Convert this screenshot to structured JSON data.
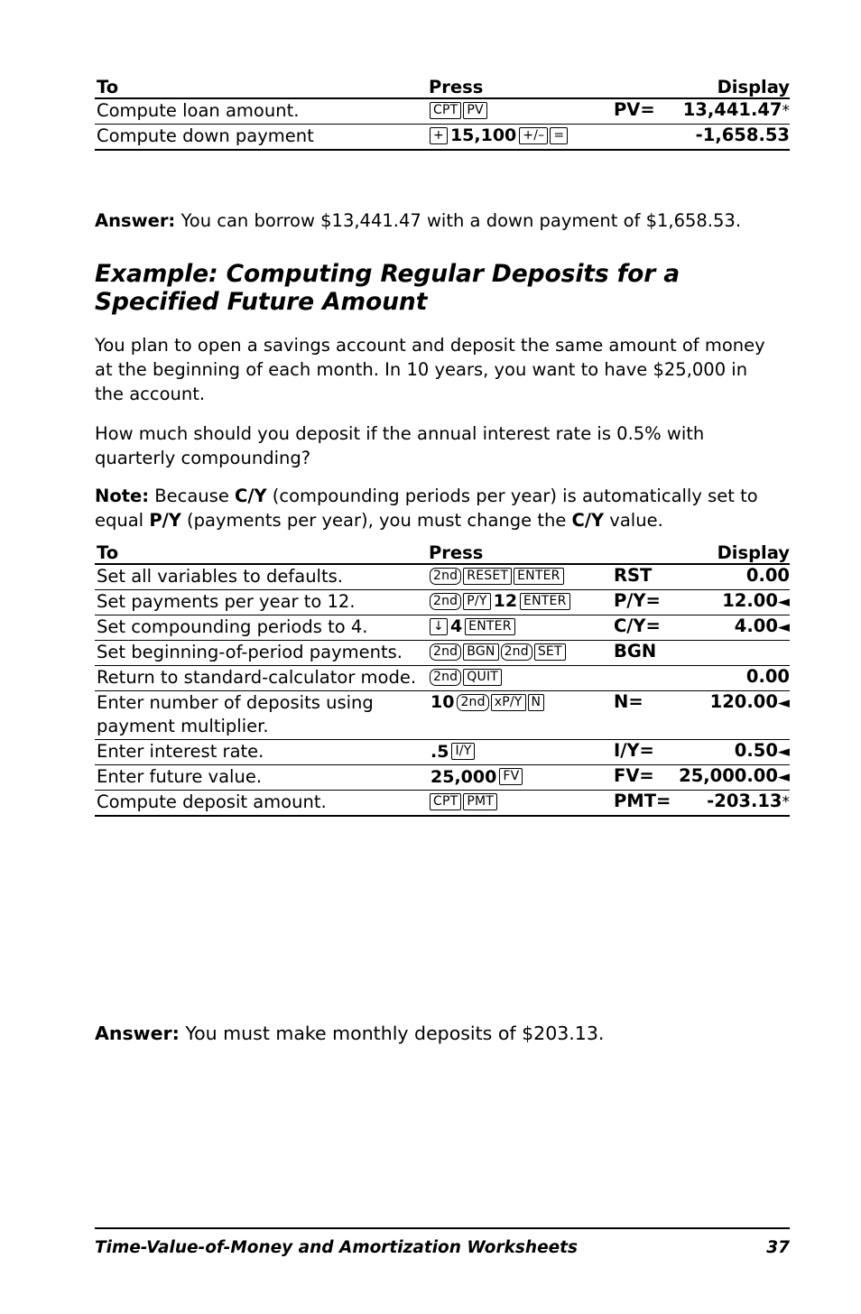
{
  "table1": {
    "headers": {
      "to": "To",
      "press": "Press",
      "display": "Display"
    },
    "rows": [
      {
        "to": "Compute loan amount.",
        "keys": [
          {
            "type": "key",
            "text": "CPT"
          },
          {
            "type": "key",
            "text": "PV"
          }
        ],
        "disp_label": "PV=",
        "disp_value": "13,441.47",
        "mark": "*"
      },
      {
        "to": "Compute down payment",
        "keys": [
          {
            "type": "key",
            "text": "+"
          },
          {
            "type": "num",
            "text": "15,100"
          },
          {
            "type": "key",
            "text": "+/–"
          },
          {
            "type": "key",
            "text": "="
          }
        ],
        "disp_label": "",
        "disp_value": "-1,658.53",
        "mark": ""
      }
    ]
  },
  "answer1": {
    "label": "Answer:",
    "text": " You can borrow $13,441.47 with a down payment of $1,658.53."
  },
  "heading": "Example: Computing Regular Deposits for a Specified Future Amount",
  "para1": "You plan to open a savings account and deposit the same amount of money at the beginning of each month. In 10 years, you want to have $25,000 in the account.",
  "para2": "How much should you deposit if the annual interest rate is 0.5% with quarterly compounding?",
  "note": {
    "label": "Note:",
    "part1": " Because ",
    "cy1": "C/Y",
    "part2": " (compounding periods per year) is automatically set to equal ",
    "py": "P/Y",
    "part3": " (payments per year), you must change the ",
    "cy2": "C/Y",
    "part4": " value."
  },
  "table2": {
    "headers": {
      "to": "To",
      "press": "Press",
      "display": "Display"
    },
    "rows": [
      {
        "to": "Set all variables to defaults.",
        "keys": [
          {
            "type": "key2nd",
            "text": "2nd"
          },
          {
            "type": "key",
            "text": "RESET"
          },
          {
            "type": "key",
            "text": "ENTER"
          }
        ],
        "disp_label": "RST",
        "disp_value": "0.00",
        "mark": ""
      },
      {
        "to": "Set payments per year to 12.",
        "keys": [
          {
            "type": "key2nd",
            "text": "2nd"
          },
          {
            "type": "key",
            "text": "P/Y"
          },
          {
            "type": "num",
            "text": "12"
          },
          {
            "type": "key",
            "text": "ENTER"
          }
        ],
        "disp_label": "P/Y=",
        "disp_value": "12.00",
        "mark": "◄"
      },
      {
        "to": "Set compounding periods to 4.",
        "keys": [
          {
            "type": "key",
            "text": "↓"
          },
          {
            "type": "num",
            "text": "4"
          },
          {
            "type": "key",
            "text": "ENTER"
          }
        ],
        "disp_label": "C/Y=",
        "disp_value": "4.00",
        "mark": "◄"
      },
      {
        "to": "Set beginning-of-period payments.",
        "keys": [
          {
            "type": "key2nd",
            "text": "2nd"
          },
          {
            "type": "key",
            "text": "BGN"
          },
          {
            "type": "key2nd",
            "text": "2nd"
          },
          {
            "type": "key",
            "text": "SET"
          }
        ],
        "disp_label": "BGN",
        "disp_value": "",
        "mark": ""
      },
      {
        "to": "Return to standard-calculator mode.",
        "keys": [
          {
            "type": "key2nd",
            "text": "2nd"
          },
          {
            "type": "key",
            "text": "QUIT"
          }
        ],
        "disp_label": "",
        "disp_value": "0.00",
        "mark": ""
      },
      {
        "to": "Enter number of deposits using payment multiplier.",
        "keys": [
          {
            "type": "num",
            "text": "10"
          },
          {
            "type": "key2nd",
            "text": "2nd"
          },
          {
            "type": "key",
            "text": "xP/Y"
          },
          {
            "type": "key",
            "text": "N"
          }
        ],
        "disp_label": "N=",
        "disp_value": "120.00",
        "mark": "◄"
      },
      {
        "to": "Enter interest rate.",
        "keys": [
          {
            "type": "num",
            "text": ".5"
          },
          {
            "type": "key",
            "text": "I/Y"
          }
        ],
        "disp_label": "I/Y=",
        "disp_value": "0.50",
        "mark": "◄"
      },
      {
        "to": "Enter future value.",
        "keys": [
          {
            "type": "num",
            "text": "25,000"
          },
          {
            "type": "key",
            "text": "FV"
          }
        ],
        "disp_label": "FV=",
        "disp_value": "25,000.00",
        "mark": "◄"
      },
      {
        "to": "Compute deposit amount.",
        "keys": [
          {
            "type": "key",
            "text": "CPT"
          },
          {
            "type": "key",
            "text": "PMT"
          }
        ],
        "disp_label": "PMT=",
        "disp_value": "-203.13",
        "mark": "*"
      }
    ]
  },
  "answer2": {
    "label": "Answer:",
    "text": " You must make monthly deposits of $203.13."
  },
  "footer": {
    "title": "Time-Value-of-Money and Amortization Worksheets",
    "page": "37"
  }
}
